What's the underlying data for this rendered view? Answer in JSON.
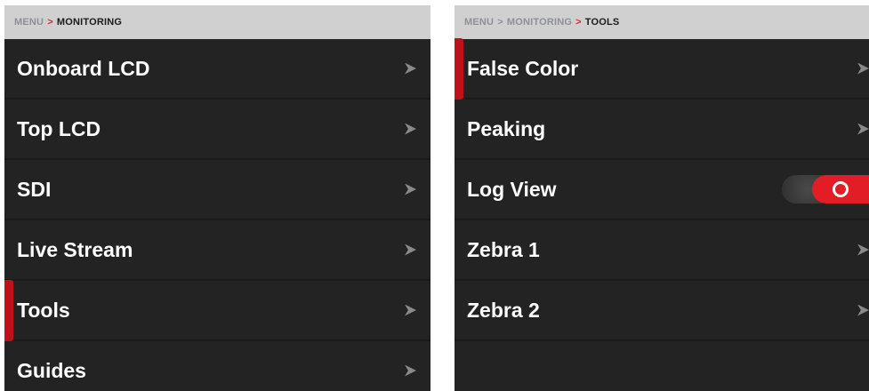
{
  "colors": {
    "accent": "#e2222b",
    "panel_bg": "#232323",
    "crumb_bg": "#d0d0d0",
    "text": "#ffffff"
  },
  "left": {
    "breadcrumb": {
      "menu": "MENU",
      "sep": ">",
      "current": "MONITORING"
    },
    "items": [
      {
        "label": "Onboard LCD",
        "icon": "chevron-right-icon"
      },
      {
        "label": "Top LCD",
        "icon": "chevron-right-icon"
      },
      {
        "label": "SDI",
        "icon": "chevron-right-icon"
      },
      {
        "label": "Live Stream",
        "icon": "chevron-right-icon"
      },
      {
        "label": "Tools",
        "icon": "chevron-right-icon",
        "selected": true
      },
      {
        "label": "Guides",
        "icon": "chevron-right-icon"
      }
    ]
  },
  "right": {
    "breadcrumb": {
      "menu": "MENU",
      "sep1": ">",
      "parent": "MONITORING",
      "sep2": ">",
      "current": "TOOLS"
    },
    "items": [
      {
        "label": "False Color",
        "icon": "chevron-right-icon",
        "selected": true
      },
      {
        "label": "Peaking",
        "icon": "chevron-right-icon"
      },
      {
        "label": "Log View",
        "control": "toggle",
        "toggle_state": "on"
      },
      {
        "label": "Zebra 1",
        "icon": "chevron-right-icon"
      },
      {
        "label": "Zebra 2",
        "icon": "chevron-right-icon"
      }
    ]
  }
}
